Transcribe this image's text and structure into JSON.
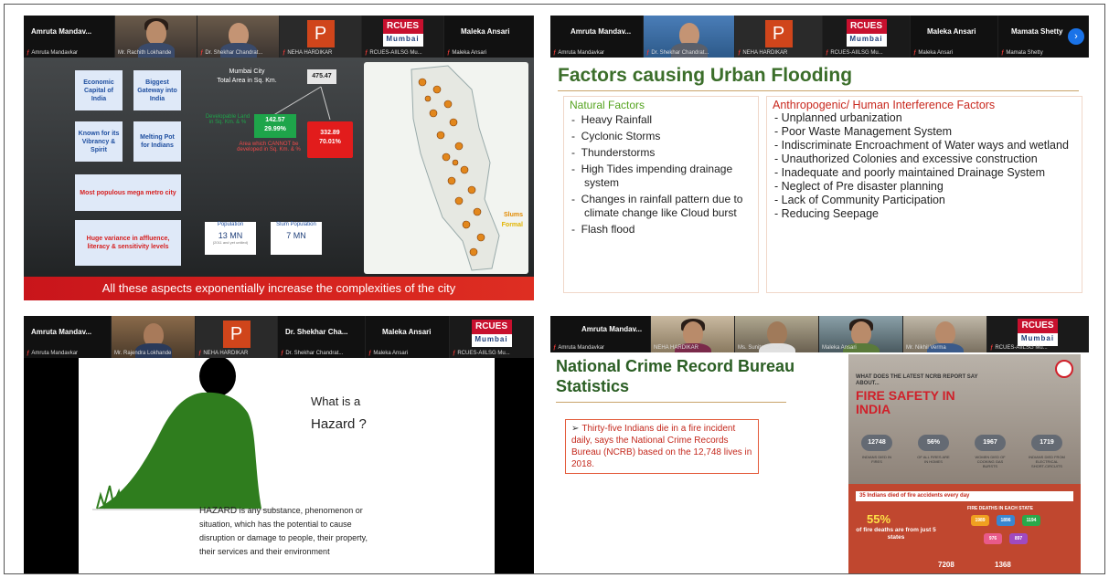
{
  "panel1": {
    "participants": [
      {
        "name": "Amruta Mandav...",
        "caption": "Amruta Mandavkar"
      },
      {
        "name": "",
        "caption": "Mr. Rachith Lokhande"
      },
      {
        "name": "",
        "caption": "Dr. Shekhar Chandrat..."
      },
      {
        "name": "",
        "caption": "NEHA HARDIKAR"
      },
      {
        "name": "",
        "caption": "RCUES-AIILSG Mu..."
      },
      {
        "name": "Maleka Ansari",
        "caption": "Maleka Ansari"
      }
    ],
    "slide": {
      "box_economic": "Economic Capital of India",
      "box_gateway": "Biggest Gateway into India",
      "box_vibrancy": "Known for its Vibrancy & Spirit",
      "box_melting": "Melting Pot for Indians",
      "box_populous": "Most populous mega metro city",
      "box_variance": "Huge variance in affluence, literacy & sensitivity levels",
      "mumbai_city": "Mumbai City",
      "total_area": "Total Area in Sq. Km.",
      "total_value": "475.47",
      "green_value": "142.57",
      "green_pct": "29.99%",
      "green_label": "Developable Land in Sq. Km. & %",
      "red_value": "332.89",
      "red_pct": "70.01%",
      "red_label": "Area which CANNOT be developed in Sq. Km. & %",
      "pop_label": "Population",
      "pop_value": "13 MN",
      "pop_foot": "(2011 and yet untiled)",
      "slum_label": "Slum Population",
      "slum_value": "7 MN",
      "legend_slums": "Slums",
      "legend_formal": "Formal",
      "banner": "All these aspects exponentially increase the complexities of the city"
    }
  },
  "panel2": {
    "participants": [
      {
        "name": "Amruta Mandav...",
        "caption": "Amruta Mandavkar"
      },
      {
        "name": "",
        "caption": "Dr. Shekhar Chandrat..."
      },
      {
        "name": "",
        "caption": "NEHA HARDIKAR"
      },
      {
        "name": "",
        "caption": "RCUES-AIILSG Mu..."
      },
      {
        "name": "Maleka Ansari",
        "caption": "Maleka Ansari"
      },
      {
        "name": "Mamata Shetty",
        "caption": "Mamata Shetty"
      }
    ],
    "title": "Factors causing Urban Flooding",
    "natural_heading": "Natural Factors",
    "natural": [
      "Heavy Rainfall",
      "Cyclonic Storms",
      "Thunderstorms",
      "High Tides impending drainage system",
      "Changes in rainfall pattern due to climate change like Cloud burst",
      "Flash flood"
    ],
    "anthro_heading": "Anthropogenic/ Human Interference Factors",
    "anthro": [
      "Unplanned urbanization",
      "Poor Waste Management System",
      "Indiscriminate Encroachment of Water ways and wetland",
      "Unauthorized Colonies and excessive construction",
      "Inadequate and poorly maintained Drainage System",
      "Neglect of Pre disaster planning",
      "Lack of Community Participation",
      "Reducing Seepage"
    ]
  },
  "panel3": {
    "participants": [
      {
        "name": "Amruta Mandav...",
        "caption": "Amruta Mandavkar"
      },
      {
        "name": "",
        "caption": "Mr. Rajendra Lokhande"
      },
      {
        "name": "",
        "caption": "NEHA HARDIKAR"
      },
      {
        "name": "Dr. Shekhar Cha...",
        "caption": "Dr. Shekhar Chandrat..."
      },
      {
        "name": "Maleka Ansari",
        "caption": "Maleka Ansari"
      },
      {
        "name": "",
        "caption": "RCUES-AIILSG Mu..."
      }
    ],
    "question_line1": "What is a",
    "question_line2": "Hazard ?",
    "definition_term": "HAZARD",
    "definition": " is any substance, phenomenon or situation, which has the potential to cause disruption or damage to people, their property, their services and their environment"
  },
  "panel4": {
    "participants": [
      {
        "name": "Amruta Mandav...",
        "caption": "Amruta Mandavkar"
      },
      {
        "name": "",
        "caption": "NEHA HARDIKAR"
      },
      {
        "name": "",
        "caption": "Ms. Sunita Sawant"
      },
      {
        "name": "",
        "caption": "Maleka Ansari"
      },
      {
        "name": "",
        "caption": "Mr. Nikhil Verma"
      },
      {
        "name": "",
        "caption": "RCUES-AIILSG Mu..."
      }
    ],
    "title": "National Crime Record Bureau Statistics",
    "bullet": "Thirty-five Indians die in a fire incident daily, says the National Crime Records Bureau (NCRB) based on the 12,748 lives in 2018.",
    "info": {
      "subtitle": "WHAT DOES THE LATEST NCRB REPORT SAY ABOUT...",
      "title": "FIRE SAFETY IN INDIA",
      "stats": [
        {
          "value": "12748",
          "label": "INDIANS DIED IN FIRES"
        },
        {
          "value": "56%",
          "label": "OF ALL FIRES ARE IN HOMES"
        },
        {
          "value": "1967",
          "label": "WOMEN DIED OF COOKING GAS BURSTS"
        },
        {
          "value": "1719",
          "label": "INDIANS DIED FROM ELECTRICAL SHORT-CIRCUITS"
        }
      ],
      "daily": "35 Indians died of fire accidents every day",
      "pct": "55%",
      "pct_text": "of fire deaths are from just 5 states",
      "each_state": "FIRE DEATHS IN EACH STATE",
      "states": [
        "1989",
        "1896",
        "1194",
        "976",
        "897"
      ],
      "bottom1": "7208",
      "bottom2": "1368"
    }
  },
  "colors": {
    "rcues_red": "#c8102e",
    "flood_title_green": "#3b6e2a",
    "natural_green": "#54a31e",
    "anthro_red": "#c8281e",
    "banner_red": "#d62020"
  },
  "logo": {
    "line1": "RCUES",
    "line2": "Mumbai"
  }
}
